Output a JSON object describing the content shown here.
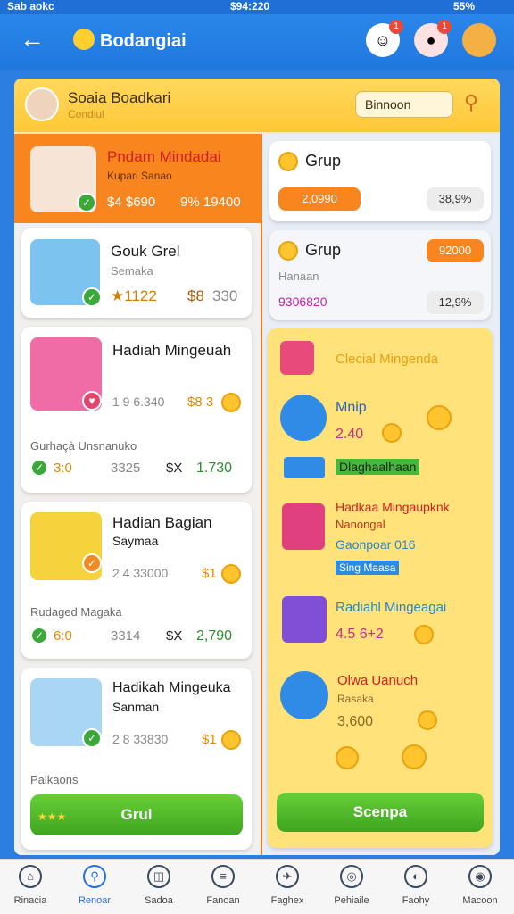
{
  "status": {
    "left": "Sab aokc",
    "center": "$94:220",
    "right": "55%"
  },
  "header": {
    "title": "Bodangiai"
  },
  "top_badges": [
    "1",
    "1"
  ],
  "user": {
    "name": "Soaia Boadkari",
    "sub": "Condiul"
  },
  "search": {
    "label": "Binnoon"
  },
  "feature": {
    "name": "Pndam Mindadai",
    "sub": "Kupari Sanao",
    "price": "$4 $690",
    "percent": "9% 19400"
  },
  "left_cards": [
    {
      "title": "Gouk Grel",
      "sub": "Semaka",
      "rating": "★1122",
      "price": "$8",
      "extra": "330"
    },
    {
      "title": "Hadiah Mingeuah",
      "stats": "1 9 6.340",
      "price": "$8 3",
      "footer": "Gurhaçà Unsnanuko",
      "f1": "3:0",
      "f2": "3325",
      "f3": "$X",
      "f4": "1.730"
    },
    {
      "title": "Hadian Bagian",
      "sub": "Saymaa",
      "stats": "2 4 33000",
      "price": "$1",
      "footer": "Rudaged Magaka",
      "f1": "6:0",
      "f2": "3314",
      "f3": "$X",
      "f4": "2,790"
    },
    {
      "title": "Hadikah Mingeuka",
      "sub": "Sanman",
      "stats": "2 8 33830",
      "price": "$1",
      "footer": "Palkaons",
      "cta": "Grul"
    }
  ],
  "right_cards": [
    {
      "title": "Grup",
      "pill": "2,0990",
      "percent": "38,9%"
    },
    {
      "title": "Grup",
      "pill": "92000",
      "sub": "Hanaan",
      "value": "9306820",
      "percent": "12,9%"
    }
  ],
  "rewards": {
    "header": "Clecial Mingenda",
    "items": [
      {
        "title": "Mnip",
        "value": "2.40",
        "tag": "Dlaghaalhaan"
      },
      {
        "title": "Hadkaa Mingaupknk",
        "sub1": "Nanongal",
        "sub2": "Gaonpoar 016",
        "tag": "Sing Maasa"
      },
      {
        "title": "Radiahl Mingeagai",
        "value": "4.5 6+2"
      },
      {
        "title": "Olwa Uanuch",
        "sub": "Rasaka",
        "value": "3,600"
      }
    ],
    "cta": "Scenpa"
  },
  "nav": [
    {
      "label": "Rinacia",
      "icon": "home-icon",
      "glyph": "⌂"
    },
    {
      "label": "Renoar",
      "icon": "search-icon",
      "glyph": "⚲"
    },
    {
      "label": "Sadoa",
      "icon": "basket-icon",
      "glyph": "◫"
    },
    {
      "label": "Fanoan",
      "icon": "list-icon",
      "glyph": "≡"
    },
    {
      "label": "Faghex",
      "icon": "plane-icon",
      "glyph": "✈"
    },
    {
      "label": "Pehiaile",
      "icon": "globe-icon",
      "glyph": "◎"
    },
    {
      "label": "Faohy",
      "icon": "plan-icon",
      "glyph": "◐"
    },
    {
      "label": "Macoon",
      "icon": "target-icon",
      "glyph": "◉"
    }
  ],
  "colors": {
    "brand": "#2a7fe0",
    "accent": "#f8851e",
    "positive": "#3ea51f",
    "price": "#d21f1f"
  }
}
